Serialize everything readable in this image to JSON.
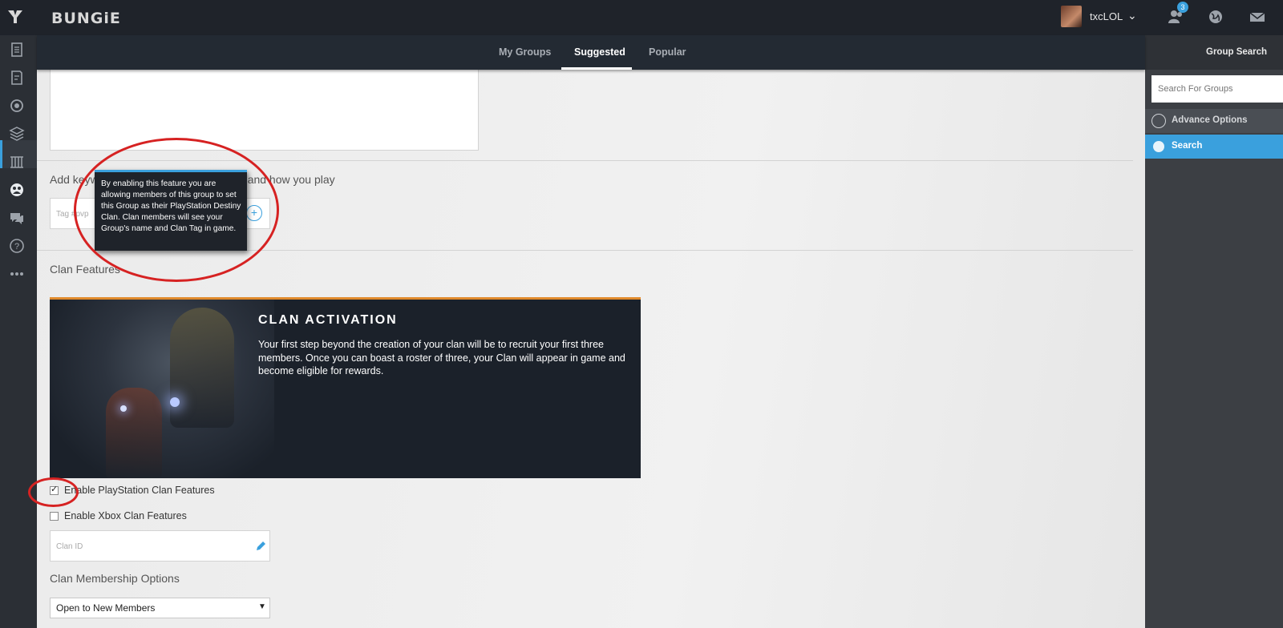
{
  "header": {
    "brand": "BUNGiE",
    "username": "txcLOL",
    "notification_count": "3"
  },
  "subnav": {
    "tabs": [
      {
        "label": "My Groups"
      },
      {
        "label": "Suggested"
      },
      {
        "label": "Popular"
      }
    ],
    "active_tab": "Suggested"
  },
  "right_panel": {
    "title": "Group Search",
    "search_placeholder": "Search For Groups",
    "advance_options_label": "Advance Options",
    "search_button_label": "Search"
  },
  "main": {
    "keywords_label": "Add keywords that describe your group and how you play",
    "keywords_placeholder": "Tag #pvp",
    "tooltip_text": "By enabling this feature you are allowing members of this group to set this Group as their PlayStation Destiny Clan. Clan members will see your Group's name and Clan Tag in game.",
    "clan_features_title": "Clan Features",
    "banner": {
      "title": "CLAN ACTIVATION",
      "text": "Your first step beyond the creation of your clan will be to recruit your first three members. Once you can boast a roster of three, your Clan will appear in game and become eligible for rewards."
    },
    "enable_playstation_label": "Enable PlayStation Clan Features",
    "enable_playstation_checked": true,
    "enable_xbox_label": "Enable Xbox Clan Features",
    "enable_xbox_checked": false,
    "clan_id_placeholder": "Clan ID",
    "membership_title": "Clan Membership Options",
    "membership_value": "Open to New Members"
  },
  "icons": {
    "left_rail": [
      "news-icon",
      "guide-icon",
      "destiny-icon",
      "layers-icon",
      "armory-icon",
      "groups-icon",
      "forums-icon",
      "help-icon",
      "more-icon"
    ],
    "top": [
      "friends-icon",
      "globe-icon",
      "mail-icon"
    ]
  },
  "colors": {
    "accent": "#3aa0dd",
    "annotation": "#d62222",
    "banner_border": "#e08a2c"
  }
}
